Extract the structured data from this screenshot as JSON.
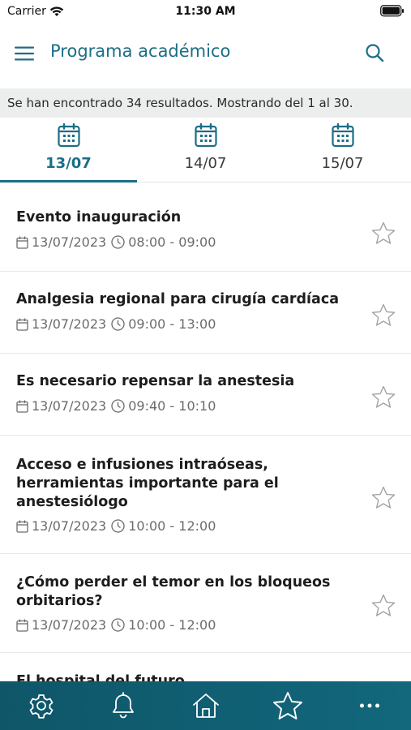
{
  "status_bar": {
    "carrier": "Carrier",
    "time": "11:30 AM",
    "wifi_icon": "wifi-icon",
    "battery_icon": "battery-icon"
  },
  "header": {
    "title": "Programa académico",
    "menu_icon": "hamburger-menu-icon",
    "search_icon": "search-icon"
  },
  "results": {
    "text": "Se han encontrado 34 resultados. Mostrando del 1 al 30."
  },
  "date_tabs": [
    {
      "label": "13/07",
      "icon": "calendar-icon",
      "active": true
    },
    {
      "label": "14/07",
      "icon": "calendar-icon",
      "active": false
    },
    {
      "label": "15/07",
      "icon": "calendar-icon",
      "active": false
    }
  ],
  "sessions": [
    {
      "title": "Evento inauguración",
      "date": "13/07/2023",
      "time": "08:00 - 09:00",
      "favorite": false
    },
    {
      "title": "Analgesia regional para cirugía cardíaca",
      "date": "13/07/2023",
      "time": "09:00 - 13:00",
      "favorite": false
    },
    {
      "title": "Es necesario repensar la anestesia",
      "date": "13/07/2023",
      "time": "09:40 - 10:10",
      "favorite": false
    },
    {
      "title": "Acceso e infusiones intraóseas, herramientas importante para el anestesiólogo",
      "date": "13/07/2023",
      "time": "10:00 - 12:00",
      "favorite": false
    },
    {
      "title": "¿Cómo perder el temor en los bloqueos orbitarios?",
      "date": "13/07/2023",
      "time": "10:00 - 12:00",
      "favorite": false
    },
    {
      "title": "El hospital del futuro",
      "date": "",
      "time": "",
      "favorite": false
    }
  ],
  "bottom_nav": [
    {
      "name": "settings",
      "icon": "gear-icon"
    },
    {
      "name": "notifications",
      "icon": "bell-icon"
    },
    {
      "name": "home",
      "icon": "home-icon"
    },
    {
      "name": "favorites",
      "icon": "star-icon"
    },
    {
      "name": "more",
      "icon": "more-dots-icon"
    }
  ],
  "colors": {
    "accent": "#1c6e86",
    "nav_background": "#106074",
    "results_background": "#eceded"
  }
}
